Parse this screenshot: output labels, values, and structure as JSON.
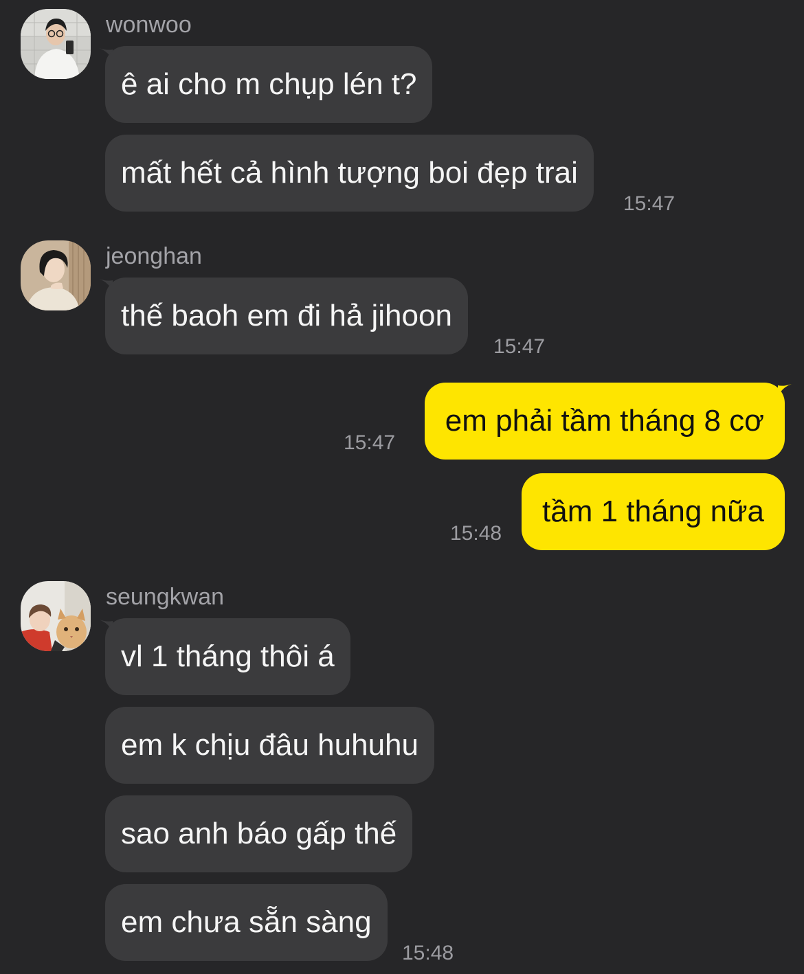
{
  "colors": {
    "background": "#262628",
    "incoming_bubble": "#3b3b3d",
    "outgoing_bubble": "#fee500"
  },
  "groups": [
    {
      "sender": "wonwoo",
      "avatar": "wonwoo-avatar",
      "messages": [
        "ê ai cho m chụp lén t?",
        "mất hết cả hình tượng boi đẹp trai"
      ],
      "time": "15:47"
    },
    {
      "sender": "jeonghan",
      "avatar": "jeonghan-avatar",
      "messages": [
        "thế baoh em đi hả jihoon"
      ],
      "time": "15:47"
    },
    {
      "sender": "me",
      "outgoing": true,
      "messages": [
        {
          "text": "em phải tầm tháng 8 cơ",
          "time": "15:47"
        },
        {
          "text": "tầm 1 tháng nữa",
          "time": "15:48"
        }
      ]
    },
    {
      "sender": "seungkwan",
      "avatar": "seungkwan-avatar",
      "messages": [
        "vl 1 tháng thôi á",
        "em k chịu đâu huhuhu",
        "sao anh báo gấp thế",
        "em chưa sẵn sàng"
      ],
      "time": "15:48"
    }
  ]
}
